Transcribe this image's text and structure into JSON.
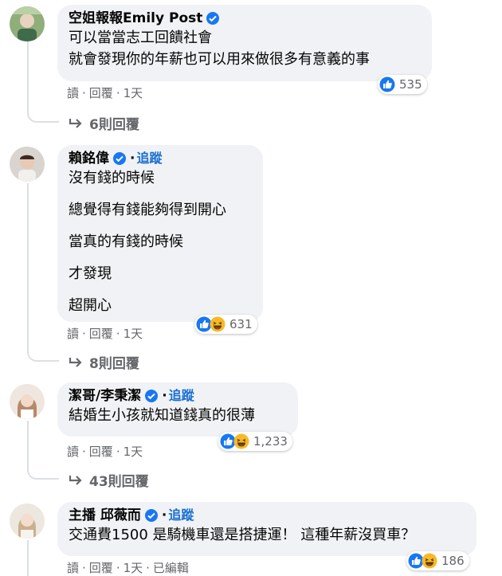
{
  "comments": [
    {
      "author": "空姐報報Emily Post",
      "verified": true,
      "follow_label": "",
      "lines": [
        "可以當當志工回饋社會",
        "就會發現你的年薪也可以用來做很多有意義的事"
      ],
      "reaction_count": "535",
      "reaction_icons": [
        "like-icon"
      ],
      "actions": [
        "讀",
        "回覆",
        "1天"
      ],
      "replies_label": "6則回覆"
    },
    {
      "author": "賴銘偉",
      "verified": true,
      "follow_label": "追蹤",
      "lines": [
        "沒有錢的時候",
        "總覺得有錢能夠得到開心",
        "當真的有錢的時候",
        "才發現",
        "超開心"
      ],
      "reaction_count": "631",
      "reaction_icons": [
        "like-icon",
        "haha-icon"
      ],
      "actions": [
        "讀",
        "回覆",
        "1天"
      ],
      "replies_label": "8則回覆"
    },
    {
      "author": "潔哥/李秉潔",
      "verified": true,
      "follow_label": "追蹤",
      "lines": [
        "結婚生小孩就知道錢真的很薄"
      ],
      "reaction_count": "1,233",
      "reaction_icons": [
        "like-icon",
        "haha-icon"
      ],
      "actions": [
        "讀",
        "回覆",
        "1天"
      ],
      "replies_label": "43則回覆"
    },
    {
      "author": "主播 邱薇而",
      "verified": true,
      "follow_label": "追蹤",
      "lines": [
        "交通費1500 是騎機車還是搭捷運！ 這種年薪沒買車？"
      ],
      "reaction_count": "186",
      "reaction_icons": [
        "like-icon",
        "haha-icon"
      ],
      "actions": [
        "讀",
        "回覆",
        "1天",
        "已編輯"
      ],
      "replies_label": ""
    }
  ],
  "colors": {
    "bubble": "#f0f2f5",
    "link": "#1a6fd1",
    "meta": "#65676b",
    "like": "#1877f2",
    "haha": "#f7b928"
  }
}
